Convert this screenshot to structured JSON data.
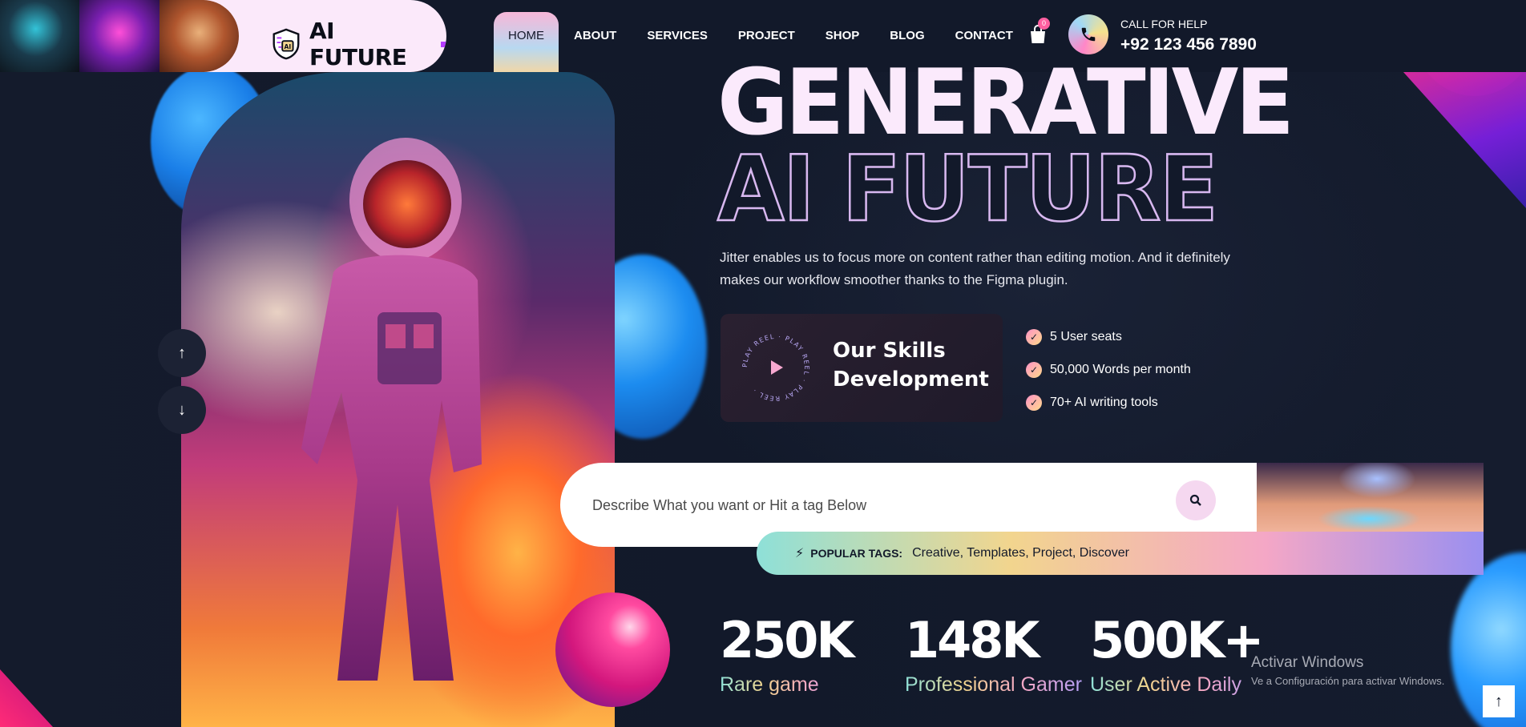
{
  "brand": {
    "name": "AI FUTURE"
  },
  "nav": {
    "items": [
      "HOME",
      "ABOUT",
      "SERVICES",
      "PROJECT",
      "SHOP",
      "BLOG",
      "CONTACT"
    ],
    "active": "HOME"
  },
  "cart": {
    "count": "0",
    "icon": "shopping-bag-icon"
  },
  "help": {
    "label": "CALL FOR HELP",
    "phone": "+92 123 456 7890",
    "icon": "phone-icon"
  },
  "hero": {
    "title_line1": "GENERATIVE",
    "title_line2": "AI FUTURE",
    "description": "Jitter enables us to focus more on content rather than editing motion. And it definitely makes our workflow smoother thanks to the Figma plugin.",
    "reel": {
      "ring_text": "PLAY REEL · PLAY REEL · PLAY REEL · ",
      "title_line1": "Our Skills",
      "title_line2": "Development"
    },
    "features": [
      "5 User seats",
      "50,000 Words per month",
      "70+ AI writing tools"
    ]
  },
  "search": {
    "placeholder": "Describe What you want or Hit a tag Below",
    "tags_label": "POPULAR TAGS:",
    "tags": "Creative, Templates, Project, Discover"
  },
  "stats": [
    {
      "value": "250K",
      "label": "Rare game"
    },
    {
      "value": "148K",
      "label": "Professional Gamer"
    },
    {
      "value": "500K+",
      "label": "User Active Daily"
    }
  ],
  "windows": {
    "title": "Activar Windows",
    "subtitle": "Ve a Configuración para activar Windows."
  },
  "colors": {
    "background": "#12192a",
    "accent_pink": "#ff4aa0",
    "accent_blue": "#1c8cf0",
    "gradient_start": "#8ee0d8",
    "gradient_end": "#9a8ff0"
  }
}
